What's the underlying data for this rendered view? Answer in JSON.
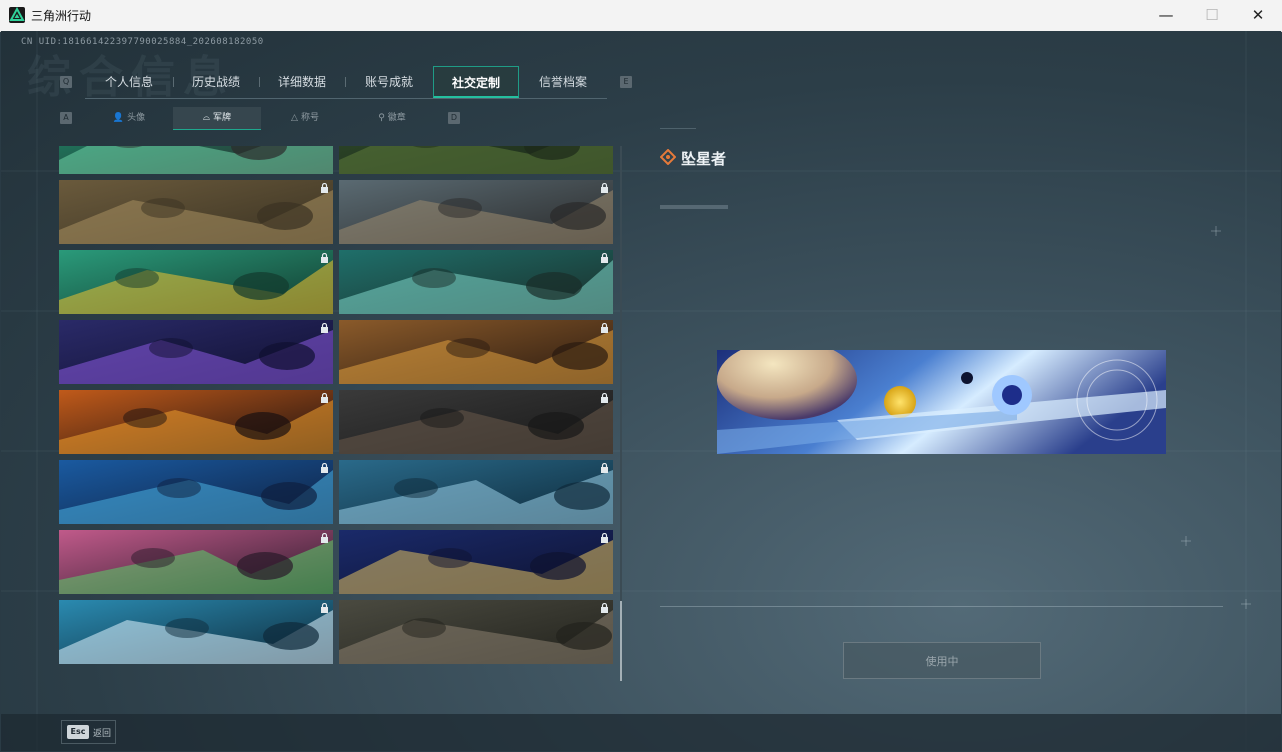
{
  "window": {
    "title": "三角洲行动",
    "minimize": "—",
    "maximize": "☐",
    "close": "✕"
  },
  "header": {
    "watermark": "综合信息",
    "uid": "CN UID:181661422397790025884_202608182050"
  },
  "tabs": {
    "left_key": "Q",
    "right_key": "E",
    "items": [
      {
        "label": "个人信息"
      },
      {
        "label": "历史战绩"
      },
      {
        "label": "详细数据"
      },
      {
        "label": "账号成就"
      },
      {
        "label": "社交定制",
        "active": true
      },
      {
        "label": "信誉档案"
      }
    ]
  },
  "subtabs": {
    "left_key": "A",
    "right_key": "D",
    "items": [
      {
        "label": "头像",
        "icon": "person-icon"
      },
      {
        "label": "军牌",
        "icon": "dogtag-icon",
        "active": true
      },
      {
        "label": "称号",
        "icon": "title-icon"
      },
      {
        "label": "徽章",
        "icon": "badge-icon"
      }
    ]
  },
  "cards": [
    {
      "theme": "green-vine",
      "locked": false
    },
    {
      "theme": "forest-soldier",
      "locked": false
    },
    {
      "theme": "desert-tank",
      "locked": true
    },
    {
      "theme": "desert-armor",
      "locked": true
    },
    {
      "theme": "green-logo",
      "locked": true
    },
    {
      "theme": "teal-drone",
      "locked": true
    },
    {
      "theme": "purple-lightning",
      "locked": true
    },
    {
      "theme": "orange-soldier",
      "locked": true
    },
    {
      "theme": "orange-burst",
      "locked": true
    },
    {
      "theme": "dark-room",
      "locked": true
    },
    {
      "theme": "blue-wave",
      "locked": true
    },
    {
      "theme": "blue-robot",
      "locked": true
    },
    {
      "theme": "pink-green",
      "locked": true
    },
    {
      "theme": "navy-hand",
      "locked": true
    },
    {
      "theme": "cyan-explosion",
      "locked": true
    },
    {
      "theme": "ruins",
      "locked": true
    }
  ],
  "detail": {
    "name": "坠星者",
    "name_icon": "diamond-target-icon",
    "use_button": "使用中"
  },
  "footer": {
    "esc_key": "Esc",
    "esc_label": "返回"
  },
  "colors": {
    "accent": "#24c09f",
    "name_icon": "#e57a3a"
  }
}
